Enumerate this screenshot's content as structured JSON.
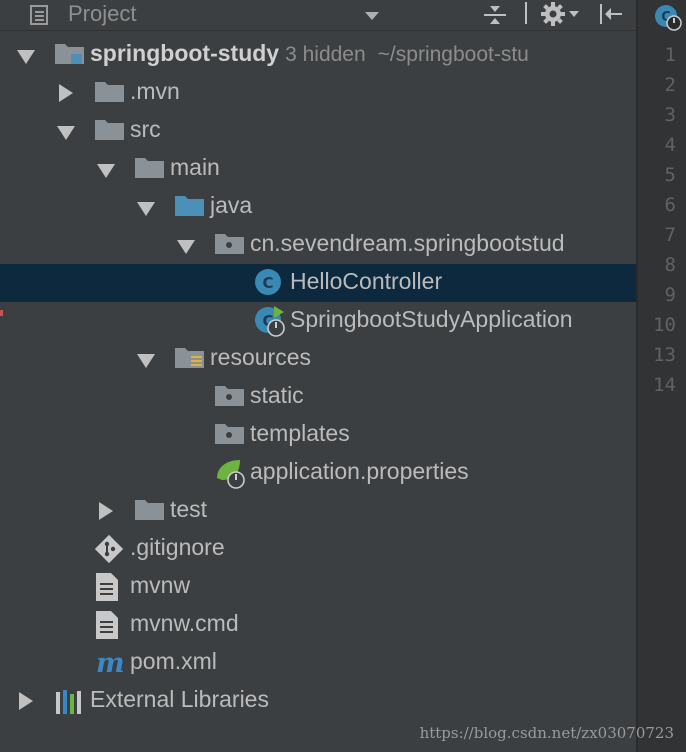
{
  "toolbar": {
    "title": "Project",
    "icons": [
      "project-view-icon",
      "dropdown-icon",
      "collapse-all-icon",
      "settings-gear-icon",
      "hide-panel-icon"
    ]
  },
  "tree": [
    {
      "label": "springboot-study",
      "hint": "3 hidden",
      "path": "~/springboot-stu",
      "icon": "module-folder",
      "depth": 0,
      "arrow": "down",
      "bold": true
    },
    {
      "label": ".mvn",
      "icon": "folder",
      "depth": 1,
      "arrow": "right"
    },
    {
      "label": "src",
      "icon": "folder",
      "depth": 1,
      "arrow": "down"
    },
    {
      "label": "main",
      "icon": "folder",
      "depth": 2,
      "arrow": "down"
    },
    {
      "label": "java",
      "icon": "source-folder",
      "depth": 3,
      "arrow": "down"
    },
    {
      "label": "cn.sevendream.springbootstud",
      "icon": "package",
      "depth": 4,
      "arrow": "down"
    },
    {
      "label": "HelloController",
      "icon": "java-class",
      "depth": 5,
      "arrow": "none",
      "selected": true
    },
    {
      "label": "SpringbootStudyApplication",
      "icon": "spring-boot-class",
      "depth": 5,
      "arrow": "none"
    },
    {
      "label": "resources",
      "icon": "resources-folder",
      "depth": 3,
      "arrow": "down"
    },
    {
      "label": "static",
      "icon": "package",
      "depth": 4,
      "arrow": "none"
    },
    {
      "label": "templates",
      "icon": "package",
      "depth": 4,
      "arrow": "none"
    },
    {
      "label": "application.properties",
      "icon": "spring-properties",
      "depth": 4,
      "arrow": "none"
    },
    {
      "label": "test",
      "icon": "folder",
      "depth": 2,
      "arrow": "right"
    },
    {
      "label": ".gitignore",
      "icon": "git-file",
      "depth": 1,
      "arrow": "none"
    },
    {
      "label": "mvnw",
      "icon": "text-file",
      "depth": 1,
      "arrow": "none"
    },
    {
      "label": "mvnw.cmd",
      "icon": "text-file",
      "depth": 1,
      "arrow": "none"
    },
    {
      "label": "pom.xml",
      "icon": "maven-file",
      "depth": 1,
      "arrow": "none"
    },
    {
      "label": "External Libraries",
      "icon": "libraries",
      "depth": 0,
      "arrow": "right"
    }
  ],
  "gutter": {
    "line_numbers": [
      "1",
      "2",
      "3",
      "4",
      "5",
      "6",
      "7",
      "8",
      "9",
      "10",
      "13",
      "14"
    ]
  },
  "watermark": "https://blog.csdn.net/zx03070723",
  "colors": {
    "panel_bg": "#3c3f41",
    "selection_bg": "#0d293e",
    "folder": "#8b9297",
    "source_folder": "#4c8fb8",
    "class_circle": "#3a88b4",
    "spring_green": "#6db33f"
  }
}
